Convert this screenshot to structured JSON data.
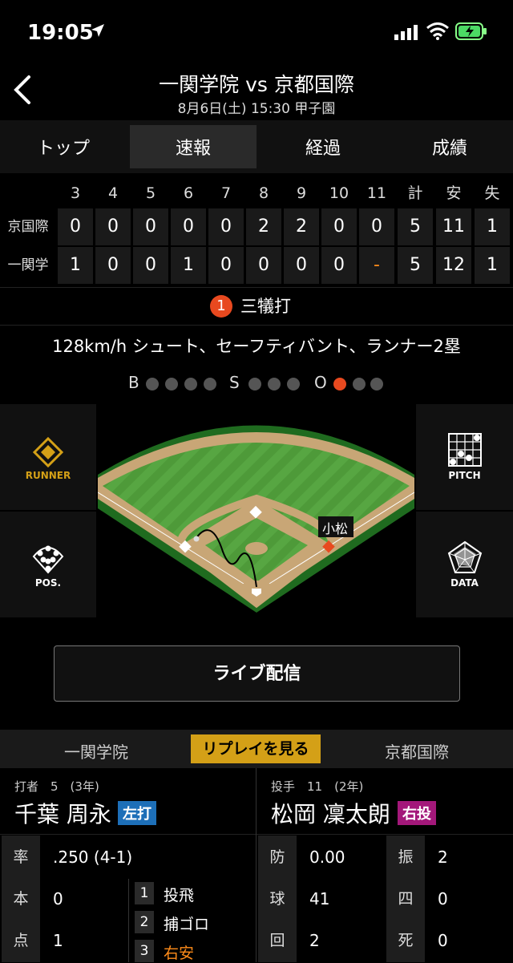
{
  "status_bar": {
    "time": "19:05"
  },
  "header": {
    "title": "一関学院 vs 京都国際",
    "subtitle": "8月6日(土) 15:30 甲子園"
  },
  "tabs": [
    {
      "label": "トップ",
      "active": false
    },
    {
      "label": "速報",
      "active": true
    },
    {
      "label": "経過",
      "active": false
    },
    {
      "label": "成績",
      "active": false
    }
  ],
  "scoreboard": {
    "innings": [
      "3",
      "4",
      "5",
      "6",
      "7",
      "8",
      "9",
      "10",
      "11"
    ],
    "totals_headers": [
      "計",
      "安",
      "失"
    ],
    "rows": [
      {
        "team": "京国際",
        "scores": [
          "0",
          "0",
          "0",
          "0",
          "0",
          "2",
          "2",
          "0",
          "0"
        ],
        "totals": [
          "5",
          "11",
          "1"
        ]
      },
      {
        "team": "一関学",
        "scores": [
          "1",
          "0",
          "0",
          "1",
          "0",
          "0",
          "0",
          "0",
          "-"
        ],
        "totals": [
          "5",
          "12",
          "1"
        ]
      }
    ]
  },
  "play": {
    "number": "1",
    "result": "三犠打",
    "detail": "128km/h シュート、セーフティバント、ランナー2塁"
  },
  "count": {
    "balls_label": "B",
    "strikes_label": "S",
    "outs_label": "O",
    "balls": 0,
    "strikes": 0,
    "outs": 1
  },
  "field_panels": {
    "runner": "RUNNER",
    "pitch": "PITCH",
    "pos": "POS.",
    "data": "DATA"
  },
  "field": {
    "fielder_label": "小松"
  },
  "live_button": "ライブ配信",
  "team_bar": {
    "home": "一関学院",
    "replay": "リプレイを見る",
    "away": "京都国際"
  },
  "batter": {
    "meta": "打者　5　(3年)",
    "name": "千葉 周永",
    "hand": "左打",
    "stats": [
      {
        "label": "率",
        "value": ".250 (4-1)"
      },
      {
        "label": "本",
        "value": "0"
      },
      {
        "label": "点",
        "value": "1"
      }
    ],
    "at_bats": [
      {
        "num": "1",
        "result": "投飛",
        "highlight": false
      },
      {
        "num": "2",
        "result": "捕ゴロ",
        "highlight": false
      },
      {
        "num": "3",
        "result": "右安",
        "highlight": true
      }
    ]
  },
  "pitcher": {
    "meta": "投手　11　(2年)",
    "name": "松岡 凜太朗",
    "hand": "右投",
    "stats_left": [
      {
        "label": "防",
        "value": "0.00"
      },
      {
        "label": "球",
        "value": "41"
      },
      {
        "label": "回",
        "value": "2"
      }
    ],
    "stats_right": [
      {
        "label": "振",
        "value": "2"
      },
      {
        "label": "四",
        "value": "0"
      },
      {
        "label": "死",
        "value": "0"
      }
    ]
  },
  "colors": {
    "accent_orange": "#e8491f",
    "replay_gold": "#d4a017",
    "lefty_blue": "#1d6fb8",
    "righty_purple": "#a3187a"
  }
}
